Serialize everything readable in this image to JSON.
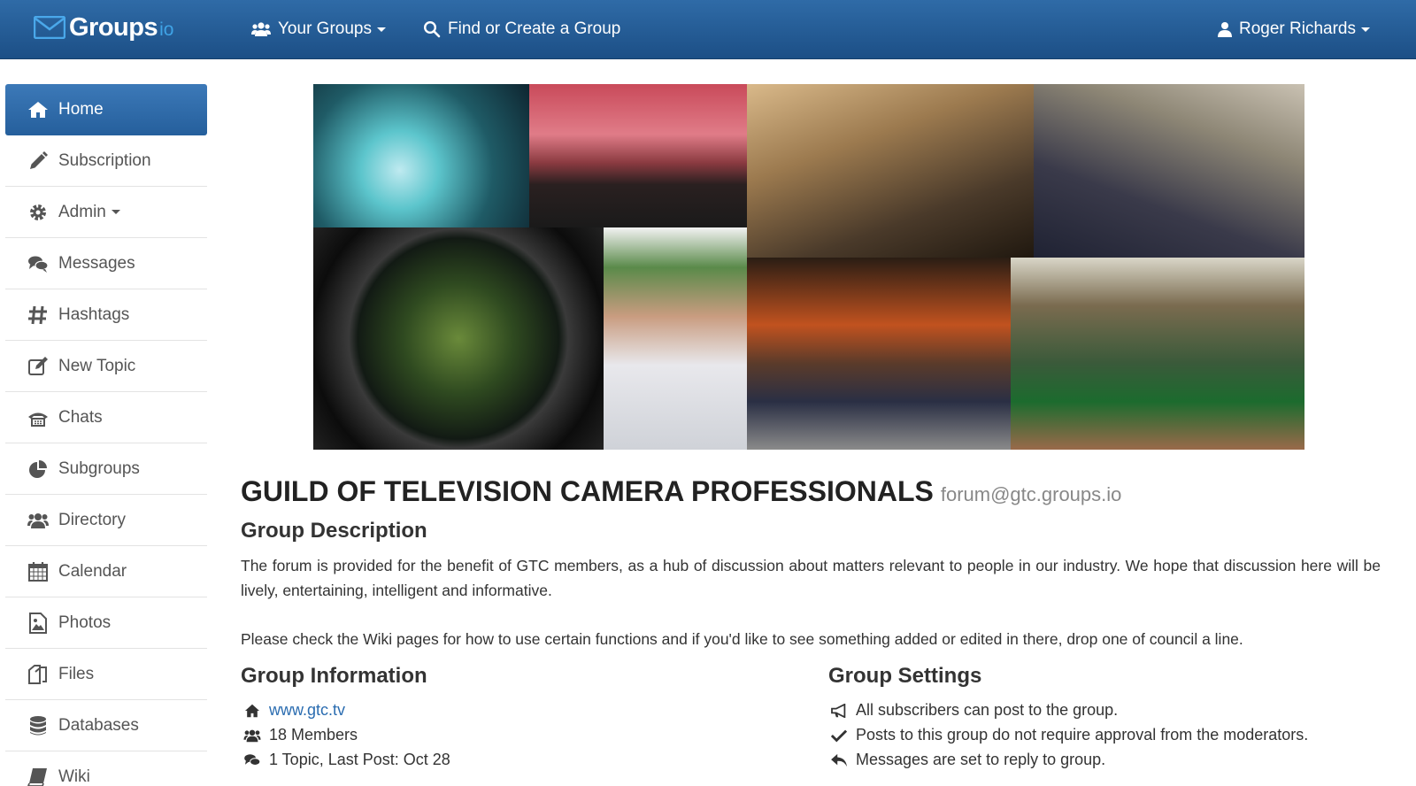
{
  "navbar": {
    "brand": "Groups",
    "brand_suffix": "io",
    "your_groups": "Your Groups",
    "find_create": "Find or Create a Group",
    "user": "Roger Richards"
  },
  "sidebar": {
    "items": [
      {
        "label": "Home",
        "icon": "home-icon"
      },
      {
        "label": "Subscription",
        "icon": "pencil-icon"
      },
      {
        "label": "Admin",
        "icon": "gear-icon"
      },
      {
        "label": "Messages",
        "icon": "comments-icon"
      },
      {
        "label": "Hashtags",
        "icon": "hashtag-icon"
      },
      {
        "label": "New Topic",
        "icon": "edit-icon"
      },
      {
        "label": "Chats",
        "icon": "chat-icon"
      },
      {
        "label": "Subgroups",
        "icon": "pie-chart-icon"
      },
      {
        "label": "Directory",
        "icon": "users-icon"
      },
      {
        "label": "Calendar",
        "icon": "calendar-icon"
      },
      {
        "label": "Photos",
        "icon": "photo-icon"
      },
      {
        "label": "Files",
        "icon": "files-icon"
      },
      {
        "label": "Databases",
        "icon": "database-icon"
      },
      {
        "label": "Wiki",
        "icon": "book-icon"
      }
    ]
  },
  "group": {
    "title": "GUILD OF TELEVISION CAMERA PROFESSIONALS",
    "email": "forum@gtc.groups.io",
    "description_heading": "Group Description",
    "description_p1": "The forum is provided for the benefit of GTC members, as a hub of discussion about matters relevant to people in our industry. We hope that discussion here will be lively, entertaining, intelligent and informative.",
    "description_p2": "Please check the Wiki pages for how to use certain functions and if you'd like to see something added or edited in there, drop one of council a line.",
    "info_heading": "Group Information",
    "website": "www.gtc.tv",
    "members": "18 Members",
    "topics": "1 Topic, Last Post: Oct 28",
    "settings_heading": "Group Settings",
    "setting_1": "All subscribers can post to the group.",
    "setting_2": "Posts to this group do not require approval from the moderators.",
    "setting_3": "Messages are set to reply to group."
  },
  "colors": {
    "navbar": "#1f558f",
    "active": "#2d6aab",
    "link": "#2a6cb0"
  }
}
